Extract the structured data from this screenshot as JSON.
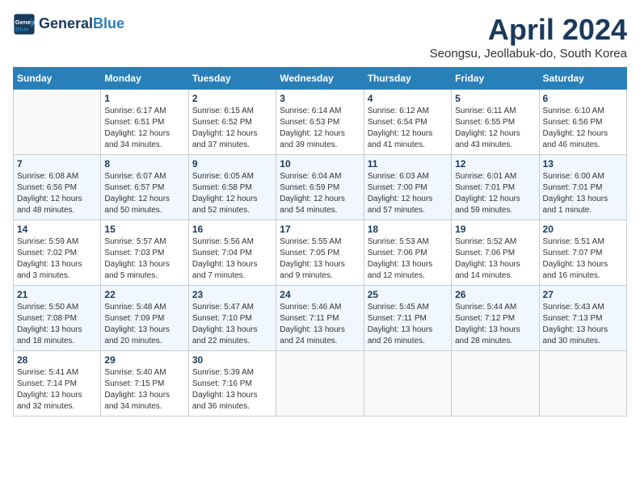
{
  "header": {
    "logo_line1": "General",
    "logo_line2": "Blue",
    "month_title": "April 2024",
    "subtitle": "Seongsu, Jeollabuk-do, South Korea"
  },
  "days_of_week": [
    "Sunday",
    "Monday",
    "Tuesday",
    "Wednesday",
    "Thursday",
    "Friday",
    "Saturday"
  ],
  "weeks": [
    [
      {
        "day": "",
        "info": ""
      },
      {
        "day": "1",
        "info": "Sunrise: 6:17 AM\nSunset: 6:51 PM\nDaylight: 12 hours\nand 34 minutes."
      },
      {
        "day": "2",
        "info": "Sunrise: 6:15 AM\nSunset: 6:52 PM\nDaylight: 12 hours\nand 37 minutes."
      },
      {
        "day": "3",
        "info": "Sunrise: 6:14 AM\nSunset: 6:53 PM\nDaylight: 12 hours\nand 39 minutes."
      },
      {
        "day": "4",
        "info": "Sunrise: 6:12 AM\nSunset: 6:54 PM\nDaylight: 12 hours\nand 41 minutes."
      },
      {
        "day": "5",
        "info": "Sunrise: 6:11 AM\nSunset: 6:55 PM\nDaylight: 12 hours\nand 43 minutes."
      },
      {
        "day": "6",
        "info": "Sunrise: 6:10 AM\nSunset: 6:56 PM\nDaylight: 12 hours\nand 46 minutes."
      }
    ],
    [
      {
        "day": "7",
        "info": "Sunrise: 6:08 AM\nSunset: 6:56 PM\nDaylight: 12 hours\nand 48 minutes."
      },
      {
        "day": "8",
        "info": "Sunrise: 6:07 AM\nSunset: 6:57 PM\nDaylight: 12 hours\nand 50 minutes."
      },
      {
        "day": "9",
        "info": "Sunrise: 6:05 AM\nSunset: 6:58 PM\nDaylight: 12 hours\nand 52 minutes."
      },
      {
        "day": "10",
        "info": "Sunrise: 6:04 AM\nSunset: 6:59 PM\nDaylight: 12 hours\nand 54 minutes."
      },
      {
        "day": "11",
        "info": "Sunrise: 6:03 AM\nSunset: 7:00 PM\nDaylight: 12 hours\nand 57 minutes."
      },
      {
        "day": "12",
        "info": "Sunrise: 6:01 AM\nSunset: 7:01 PM\nDaylight: 12 hours\nand 59 minutes."
      },
      {
        "day": "13",
        "info": "Sunrise: 6:00 AM\nSunset: 7:01 PM\nDaylight: 13 hours\nand 1 minute."
      }
    ],
    [
      {
        "day": "14",
        "info": "Sunrise: 5:59 AM\nSunset: 7:02 PM\nDaylight: 13 hours\nand 3 minutes."
      },
      {
        "day": "15",
        "info": "Sunrise: 5:57 AM\nSunset: 7:03 PM\nDaylight: 13 hours\nand 5 minutes."
      },
      {
        "day": "16",
        "info": "Sunrise: 5:56 AM\nSunset: 7:04 PM\nDaylight: 13 hours\nand 7 minutes."
      },
      {
        "day": "17",
        "info": "Sunrise: 5:55 AM\nSunset: 7:05 PM\nDaylight: 13 hours\nand 9 minutes."
      },
      {
        "day": "18",
        "info": "Sunrise: 5:53 AM\nSunset: 7:06 PM\nDaylight: 13 hours\nand 12 minutes."
      },
      {
        "day": "19",
        "info": "Sunrise: 5:52 AM\nSunset: 7:06 PM\nDaylight: 13 hours\nand 14 minutes."
      },
      {
        "day": "20",
        "info": "Sunrise: 5:51 AM\nSunset: 7:07 PM\nDaylight: 13 hours\nand 16 minutes."
      }
    ],
    [
      {
        "day": "21",
        "info": "Sunrise: 5:50 AM\nSunset: 7:08 PM\nDaylight: 13 hours\nand 18 minutes."
      },
      {
        "day": "22",
        "info": "Sunrise: 5:48 AM\nSunset: 7:09 PM\nDaylight: 13 hours\nand 20 minutes."
      },
      {
        "day": "23",
        "info": "Sunrise: 5:47 AM\nSunset: 7:10 PM\nDaylight: 13 hours\nand 22 minutes."
      },
      {
        "day": "24",
        "info": "Sunrise: 5:46 AM\nSunset: 7:11 PM\nDaylight: 13 hours\nand 24 minutes."
      },
      {
        "day": "25",
        "info": "Sunrise: 5:45 AM\nSunset: 7:11 PM\nDaylight: 13 hours\nand 26 minutes."
      },
      {
        "day": "26",
        "info": "Sunrise: 5:44 AM\nSunset: 7:12 PM\nDaylight: 13 hours\nand 28 minutes."
      },
      {
        "day": "27",
        "info": "Sunrise: 5:43 AM\nSunset: 7:13 PM\nDaylight: 13 hours\nand 30 minutes."
      }
    ],
    [
      {
        "day": "28",
        "info": "Sunrise: 5:41 AM\nSunset: 7:14 PM\nDaylight: 13 hours\nand 32 minutes."
      },
      {
        "day": "29",
        "info": "Sunrise: 5:40 AM\nSunset: 7:15 PM\nDaylight: 13 hours\nand 34 minutes."
      },
      {
        "day": "30",
        "info": "Sunrise: 5:39 AM\nSunset: 7:16 PM\nDaylight: 13 hours\nand 36 minutes."
      },
      {
        "day": "",
        "info": ""
      },
      {
        "day": "",
        "info": ""
      },
      {
        "day": "",
        "info": ""
      },
      {
        "day": "",
        "info": ""
      }
    ]
  ]
}
